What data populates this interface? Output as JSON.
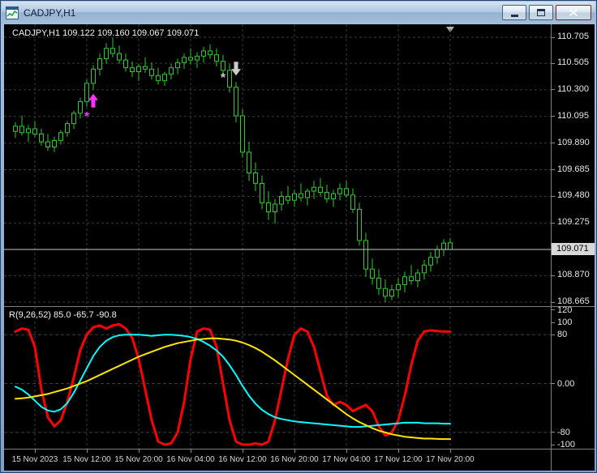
{
  "window": {
    "title": "CADJPY,H1"
  },
  "main_chart": {
    "info_label": "CADJPY,H1 109.122 109.160 109.067 109.071",
    "current_price_label": "109.071"
  },
  "indicator": {
    "label": "R(9,26,52) 85.0 -65.7 -90.8"
  },
  "colors": {
    "chart_bg": "#000000",
    "grid": "#3a3a3a",
    "level": "#404040",
    "candle": "#32c832",
    "series_red": "#ff0000",
    "series_cyan": "#00ffff",
    "series_yellow": "#ffe600",
    "current_price_line": "#c8c8c8",
    "marker_up": "#ff30ff",
    "marker_down": "#cccccc",
    "scale_text": "#e6e6e6",
    "separator": "#7f7f7f"
  },
  "chart_data": [
    {
      "type": "candlestick",
      "symbol": "CADJPY",
      "timeframe": "H1",
      "ohlc": {
        "open": 109.122,
        "high": 109.16,
        "low": 109.067,
        "close": 109.071
      },
      "ylim_top": 110.805,
      "ylim_bottom": 108.634,
      "x_start": 14,
      "x_step": 8,
      "current_price": 109.071,
      "price_ticks": [
        110.705,
        110.505,
        110.3,
        110.095,
        109.89,
        109.685,
        109.48,
        109.275,
        108.87,
        108.665
      ],
      "time_ticks": [
        {
          "bar": 3,
          "label": "15 Nov 2023"
        },
        {
          "bar": 11,
          "label": "15 Nov 12:00"
        },
        {
          "bar": 19,
          "label": "15 Nov 20:00"
        },
        {
          "bar": 27,
          "label": "16 Nov 04:00"
        },
        {
          "bar": 35,
          "label": "16 Nov 12:00"
        },
        {
          "bar": 43,
          "label": "16 Nov 20:00"
        },
        {
          "bar": 51,
          "label": "17 Nov 04:00"
        },
        {
          "bar": 59,
          "label": "17 Nov 12:00"
        },
        {
          "bar": 67,
          "label": "17 Nov 20:00"
        }
      ],
      "markers": [
        {
          "bar": 11,
          "price": 110.1,
          "type": "asterisk",
          "color_key": "marker_up"
        },
        {
          "bar": 12,
          "price": 110.27,
          "type": "arrow-up",
          "color_key": "marker_up"
        },
        {
          "bar": 32,
          "price": 110.4,
          "type": "asterisk",
          "color_key": "marker_down"
        },
        {
          "bar": 34,
          "price": 110.41,
          "type": "arrow-down",
          "color_key": "marker_down"
        }
      ],
      "candles": [
        [
          109.98,
          110.05,
          109.93,
          110.02
        ],
        [
          110.02,
          110.1,
          109.95,
          109.97
        ],
        [
          109.97,
          110.03,
          109.9,
          110.0
        ],
        [
          110.0,
          110.06,
          109.94,
          109.96
        ],
        [
          109.96,
          110.0,
          109.87,
          109.9
        ],
        [
          109.9,
          109.96,
          109.83,
          109.86
        ],
        [
          109.86,
          109.94,
          109.82,
          109.91
        ],
        [
          109.91,
          109.99,
          109.88,
          109.97
        ],
        [
          109.97,
          110.06,
          109.94,
          110.04
        ],
        [
          110.04,
          110.14,
          110.0,
          110.12
        ],
        [
          110.12,
          110.24,
          110.08,
          110.21
        ],
        [
          110.21,
          110.38,
          110.17,
          110.35
        ],
        [
          110.35,
          110.49,
          110.3,
          110.46
        ],
        [
          110.46,
          110.58,
          110.41,
          110.54
        ],
        [
          110.54,
          110.66,
          110.5,
          110.62
        ],
        [
          110.62,
          110.7,
          110.55,
          110.58
        ],
        [
          110.58,
          110.64,
          110.5,
          110.53
        ],
        [
          110.53,
          110.58,
          110.44,
          110.47
        ],
        [
          110.47,
          110.52,
          110.4,
          110.44
        ],
        [
          110.44,
          110.5,
          110.37,
          110.48
        ],
        [
          110.48,
          110.55,
          110.43,
          110.46
        ],
        [
          110.46,
          110.51,
          110.38,
          110.41
        ],
        [
          110.41,
          110.47,
          110.34,
          110.37
        ],
        [
          110.37,
          110.44,
          110.33,
          110.42
        ],
        [
          110.42,
          110.5,
          110.38,
          110.47
        ],
        [
          110.47,
          110.54,
          110.42,
          110.51
        ],
        [
          110.51,
          110.58,
          110.46,
          110.55
        ],
        [
          110.55,
          110.62,
          110.5,
          110.53
        ],
        [
          110.53,
          110.59,
          110.47,
          110.56
        ],
        [
          110.56,
          110.63,
          110.51,
          110.6
        ],
        [
          110.6,
          110.65,
          110.54,
          110.57
        ],
        [
          110.57,
          110.62,
          110.48,
          110.52
        ],
        [
          110.52,
          110.57,
          110.42,
          110.45
        ],
        [
          110.45,
          110.5,
          110.28,
          110.32
        ],
        [
          110.32,
          110.36,
          110.05,
          110.1
        ],
        [
          110.1,
          110.15,
          109.78,
          109.82
        ],
        [
          109.82,
          109.9,
          109.6,
          109.66
        ],
        [
          109.66,
          109.74,
          109.52,
          109.58
        ],
        [
          109.58,
          109.64,
          109.38,
          109.43
        ],
        [
          109.43,
          109.52,
          109.3,
          109.36
        ],
        [
          109.36,
          109.46,
          109.27,
          109.42
        ],
        [
          109.42,
          109.52,
          109.37,
          109.48
        ],
        [
          109.48,
          109.56,
          109.42,
          109.45
        ],
        [
          109.45,
          109.53,
          109.4,
          109.5
        ],
        [
          109.5,
          109.58,
          109.44,
          109.47
        ],
        [
          109.47,
          109.54,
          109.41,
          109.52
        ],
        [
          109.52,
          109.6,
          109.46,
          109.55
        ],
        [
          109.55,
          109.62,
          109.48,
          109.51
        ],
        [
          109.51,
          109.57,
          109.43,
          109.46
        ],
        [
          109.46,
          109.53,
          109.4,
          109.5
        ],
        [
          109.5,
          109.58,
          109.45,
          109.54
        ],
        [
          109.54,
          109.6,
          109.47,
          109.49
        ],
        [
          109.49,
          109.54,
          109.35,
          109.38
        ],
        [
          109.38,
          109.43,
          109.1,
          109.14
        ],
        [
          109.14,
          109.2,
          108.86,
          108.92
        ],
        [
          108.92,
          109.0,
          108.8,
          108.85
        ],
        [
          108.85,
          108.92,
          108.72,
          108.77
        ],
        [
          108.77,
          108.84,
          108.665,
          108.71
        ],
        [
          108.71,
          108.8,
          108.68,
          108.76
        ],
        [
          108.76,
          108.85,
          108.7,
          108.8
        ],
        [
          108.8,
          108.9,
          108.74,
          108.86
        ],
        [
          108.86,
          108.95,
          108.8,
          108.83
        ],
        [
          108.83,
          108.92,
          108.78,
          108.89
        ],
        [
          108.89,
          108.99,
          108.84,
          108.95
        ],
        [
          108.95,
          109.05,
          108.9,
          109.01
        ],
        [
          109.01,
          109.1,
          108.96,
          109.07
        ],
        [
          109.07,
          109.15,
          109.02,
          109.12
        ],
        [
          109.122,
          109.16,
          109.067,
          109.071
        ]
      ]
    },
    {
      "type": "line",
      "name": "R(9,26,52)",
      "current_values": [
        85.0,
        -65.7,
        -90.8
      ],
      "ylim_top": 125.3,
      "ylim_bottom": -106.6,
      "levels": [
        80,
        0,
        -80
      ],
      "scale_ticks": [
        {
          "v": 120,
          "label": "120"
        },
        {
          "v": 100,
          "label": "100"
        },
        {
          "v": 80,
          "label": "80"
        },
        {
          "v": 0,
          "label": "0.00"
        },
        {
          "v": -80,
          "label": "-80"
        },
        {
          "v": -100,
          "label": "-100"
        }
      ],
      "series": [
        {
          "name": "r-fast",
          "color_key": "series_red",
          "width": 3,
          "values": [
            85,
            90,
            88,
            60,
            -10,
            -55,
            -70,
            -60,
            -30,
            10,
            55,
            80,
            92,
            95,
            90,
            95,
            97,
            90,
            75,
            40,
            -10,
            -60,
            -95,
            -100,
            -98,
            -80,
            -30,
            40,
            85,
            90,
            88,
            60,
            0,
            -60,
            -95,
            -100,
            -100,
            -98,
            -100,
            -95,
            -60,
            -10,
            40,
            80,
            90,
            85,
            60,
            20,
            -20,
            -35,
            -30,
            -35,
            -45,
            -40,
            -35,
            -45,
            -70,
            -85,
            -80,
            -60,
            -20,
            30,
            70,
            85,
            87,
            86,
            85,
            85
          ]
        },
        {
          "name": "r-mid",
          "color_key": "series_cyan",
          "width": 2,
          "values": [
            -5,
            -10,
            -18,
            -28,
            -38,
            -44,
            -46,
            -42,
            -32,
            -15,
            5,
            25,
            45,
            60,
            70,
            76,
            79,
            80,
            80,
            80,
            79,
            78,
            79,
            80,
            80,
            79,
            78,
            76,
            73,
            68,
            62,
            54,
            44,
            30,
            14,
            -4,
            -20,
            -33,
            -43,
            -50,
            -55,
            -58,
            -60,
            -62,
            -63,
            -64,
            -65,
            -66,
            -67,
            -68,
            -69,
            -70,
            -71,
            -71,
            -70,
            -69,
            -68,
            -67,
            -66,
            -65,
            -64,
            -64,
            -64,
            -65,
            -65,
            -65,
            -65.7,
            -65.7
          ]
        },
        {
          "name": "r-slow",
          "color_key": "series_yellow",
          "width": 2,
          "values": [
            -25,
            -24,
            -23,
            -21,
            -19,
            -17,
            -14,
            -11,
            -8,
            -4,
            0,
            4,
            9,
            14,
            19,
            24,
            29,
            34,
            39,
            44,
            48,
            52,
            56,
            60,
            63,
            66,
            68,
            70,
            72,
            73,
            74,
            74,
            73,
            72,
            70,
            67,
            63,
            58,
            52,
            45,
            38,
            30,
            22,
            14,
            6,
            -2,
            -10,
            -18,
            -26,
            -34,
            -42,
            -50,
            -57,
            -63,
            -68,
            -73,
            -77,
            -80,
            -83,
            -85,
            -87,
            -88,
            -89,
            -90,
            -90,
            -90.5,
            -90.8,
            -90.8
          ]
        }
      ]
    }
  ]
}
